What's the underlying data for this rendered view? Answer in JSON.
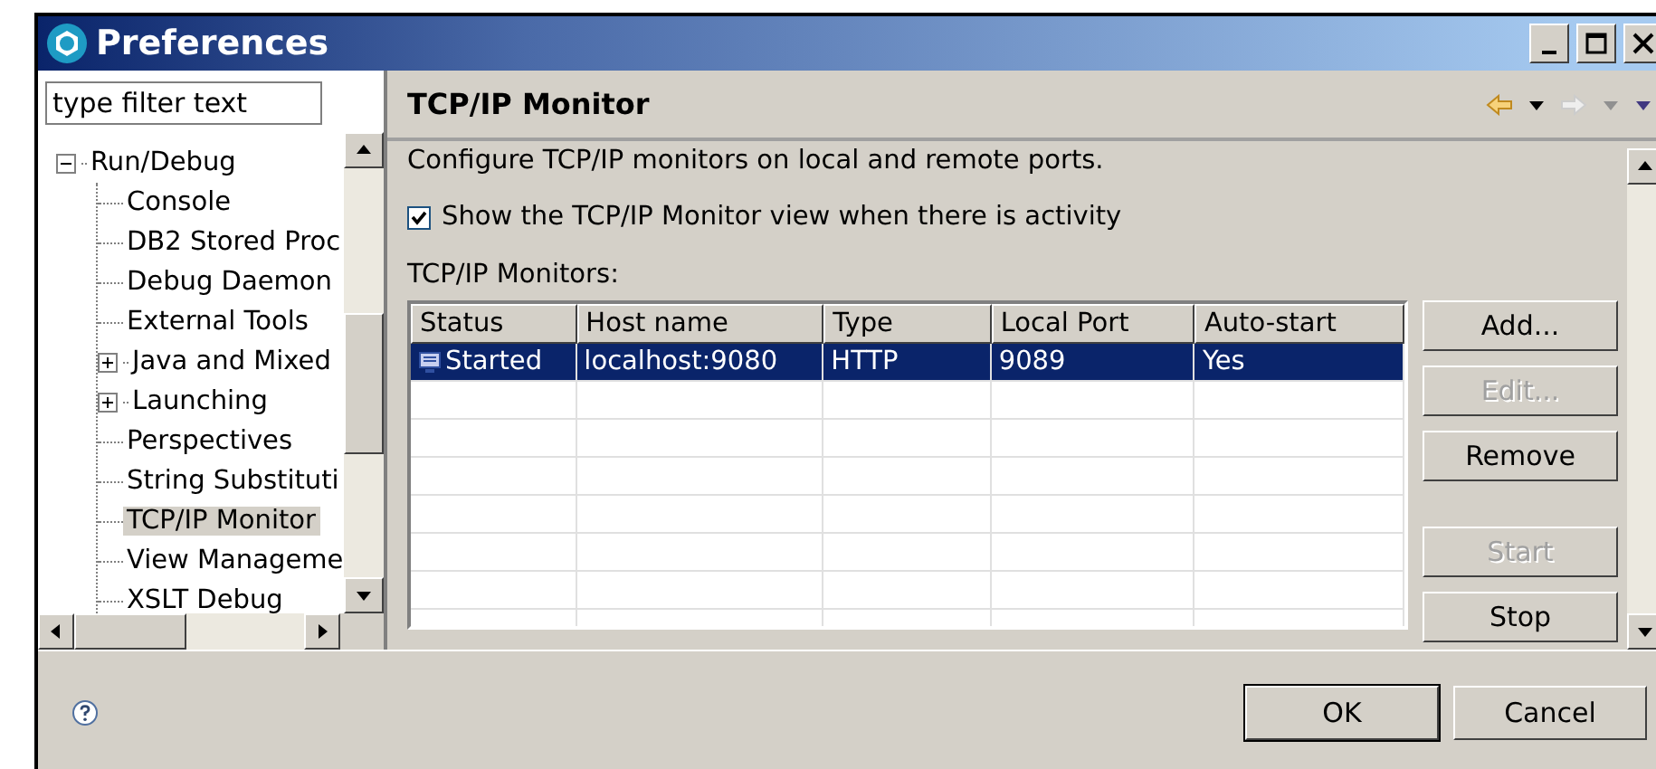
{
  "window": {
    "title": "Preferences"
  },
  "filter": {
    "placeholder": "type filter text"
  },
  "tree": [
    {
      "label": "Run/Debug",
      "kind": "node",
      "expanded": true,
      "selected": false,
      "children": [
        {
          "label": "Console",
          "kind": "leaf",
          "selected": false
        },
        {
          "label": "DB2 Stored Proc",
          "kind": "leaf",
          "selected": false
        },
        {
          "label": "Debug Daemon",
          "kind": "leaf",
          "selected": false
        },
        {
          "label": "External Tools",
          "kind": "leaf",
          "selected": false
        },
        {
          "label": "Java and Mixed",
          "kind": "node",
          "expanded": false,
          "selected": false
        },
        {
          "label": "Launching",
          "kind": "node",
          "expanded": false,
          "selected": false
        },
        {
          "label": "Perspectives",
          "kind": "leaf",
          "selected": false
        },
        {
          "label": "String Substituti",
          "kind": "leaf",
          "selected": false
        },
        {
          "label": "TCP/IP Monitor",
          "kind": "leaf",
          "selected": true
        },
        {
          "label": "View Manageme",
          "kind": "leaf",
          "selected": false
        },
        {
          "label": "XSLT Debug",
          "kind": "leaf",
          "selected": false
        }
      ]
    }
  ],
  "page": {
    "title": "TCP/IP Monitor",
    "description": "Configure TCP/IP monitors on local and remote ports.",
    "show_view_checkbox": {
      "label": "Show the TCP/IP Monitor view when there is activity",
      "checked": true
    },
    "monitors_label": "TCP/IP Monitors:",
    "table": {
      "columns": [
        "Status",
        "Host name",
        "Type",
        "Local Port",
        "Auto-start"
      ],
      "rows": [
        {
          "selected": true,
          "cells": [
            "Started",
            "localhost:9080",
            "HTTP",
            "9089",
            "Yes"
          ]
        }
      ]
    },
    "buttons": [
      {
        "label": "Add...",
        "disabled": false
      },
      {
        "label": "Edit...",
        "disabled": true
      },
      {
        "label": "Remove",
        "disabled": false
      },
      {
        "label": "Start",
        "disabled": true
      },
      {
        "label": "Stop",
        "disabled": false
      }
    ]
  },
  "dialog_buttons": [
    {
      "label": "OK",
      "default": true
    },
    {
      "label": "Cancel",
      "default": false
    }
  ]
}
